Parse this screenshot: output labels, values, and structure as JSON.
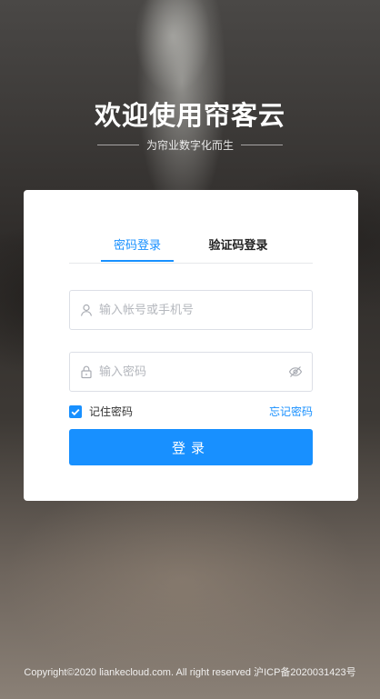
{
  "hero": {
    "title": "欢迎使用帘客云",
    "subtitle": "为帘业数字化而生"
  },
  "login": {
    "tabs": [
      {
        "label": "密码登录",
        "active": true
      },
      {
        "label": "验证码登录",
        "active": false
      }
    ],
    "account_placeholder": "输入帐号或手机号",
    "account_icon": "user-icon",
    "password_placeholder": "输入密码",
    "password_icon": "lock-icon",
    "visibility_icon": "eye-off-icon",
    "remember_label": "记住密码",
    "remember_checked": true,
    "forgot_label": "忘记密码",
    "submit_label": "登录"
  },
  "footer": {
    "text": "Copyright©2020 liankecloud.com. All right reserved 沪ICP备2020031423号"
  },
  "colors": {
    "accent": "#1890ff",
    "card_bg": "#ffffff",
    "text": "#333333"
  }
}
